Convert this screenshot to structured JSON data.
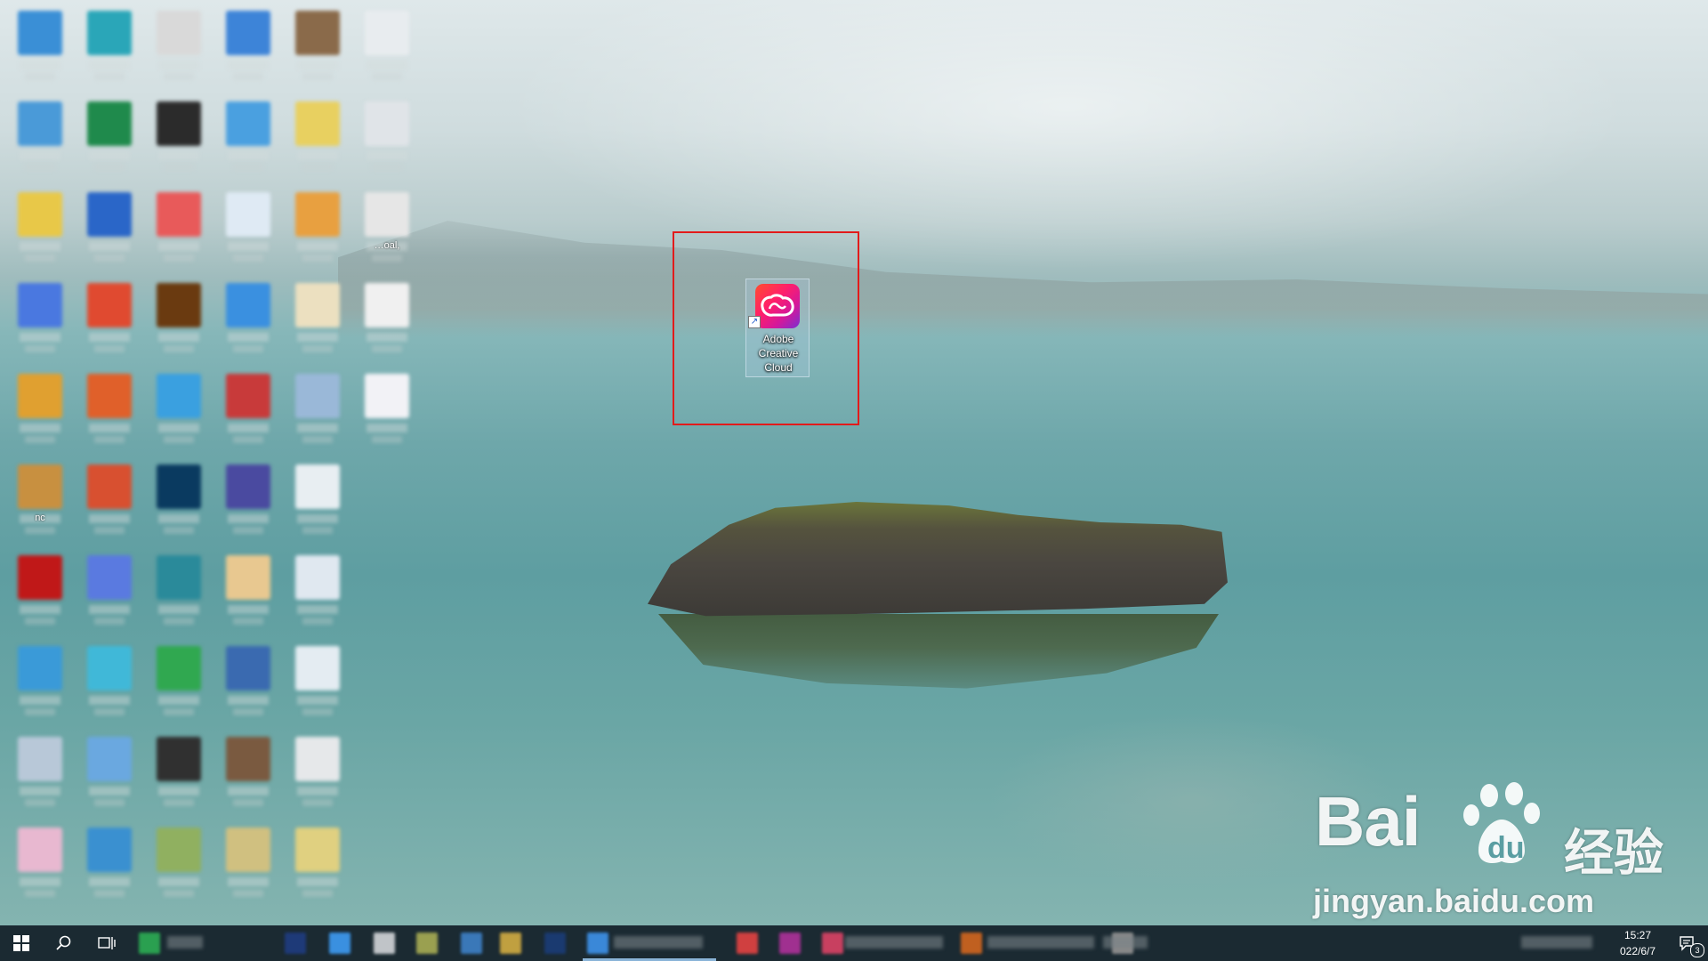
{
  "desktop": {
    "highlighted_shortcut": {
      "label_line1": "Adobe",
      "label_line2": "Creative",
      "label_line3": "Cloud",
      "shortcut_arrow": "↗",
      "icon": "adobe-creative-cloud-icon",
      "highlight_color": "#e21b1b"
    },
    "blurred_icons": [
      {
        "color": "#3a8fd6",
        "text": ""
      },
      {
        "color": "#2aa6b8",
        "text": ""
      },
      {
        "color": "#d9d9d9",
        "text": ""
      },
      {
        "color": "#3d84d8",
        "text": ""
      },
      {
        "color": "#8a6a4a",
        "text": ""
      },
      {
        "color": "#e8ecef",
        "text": ""
      },
      {
        "color": "#4a9ad8",
        "text": ""
      },
      {
        "color": "#1f8a4c",
        "text": ""
      },
      {
        "color": "#2b2b2b",
        "text": ""
      },
      {
        "color": "#4aa0e0",
        "text": ""
      },
      {
        "color": "#e8d060",
        "text": ""
      },
      {
        "color": "#e0e4e8",
        "text": ""
      },
      {
        "color": "#e8c848",
        "text": ""
      },
      {
        "color": "#2a66c8",
        "text": ""
      },
      {
        "color": "#e85a5a",
        "text": ""
      },
      {
        "color": "#dfeaf4",
        "text": ""
      },
      {
        "color": "#e8a040",
        "text": ""
      },
      {
        "color": "#e6e6e6",
        "text": "…oal,"
      },
      {
        "color": "#4a78e0",
        "text": ""
      },
      {
        "color": "#e04a30",
        "text": ""
      },
      {
        "color": "#6a3a10",
        "text": ""
      },
      {
        "color": "#3a90e0",
        "text": ""
      },
      {
        "color": "#ece0c0",
        "text": ""
      },
      {
        "color": "#f0f0f0",
        "text": ""
      },
      {
        "color": "#e0a030",
        "text": ""
      },
      {
        "color": "#e0602a",
        "text": ""
      },
      {
        "color": "#3aa0e0",
        "text": ""
      },
      {
        "color": "#c83a3a",
        "text": ""
      },
      {
        "color": "#9ab8d8",
        "text": ""
      },
      {
        "color": "#f2f2f6",
        "text": ""
      },
      {
        "color": "#c89040",
        "text": "nc"
      },
      {
        "color": "#d85030",
        "text": ""
      },
      {
        "color": "#0a3a60",
        "text": ""
      },
      {
        "color": "#4a4aa0",
        "text": ""
      },
      {
        "color": "#e8eef2",
        "text": ""
      },
      {
        "color": "",
        "text": ""
      },
      {
        "color": "#c01818",
        "text": ""
      },
      {
        "color": "#5a7ae0",
        "text": ""
      },
      {
        "color": "#2a8a9a",
        "text": ""
      },
      {
        "color": "#e8c890",
        "text": ""
      },
      {
        "color": "#e0e8f0",
        "text": ""
      },
      {
        "color": "",
        "text": ""
      },
      {
        "color": "#3a9ad8",
        "text": ""
      },
      {
        "color": "#40b8d8",
        "text": ""
      },
      {
        "color": "#30a850",
        "text": ""
      },
      {
        "color": "#3a6ab0",
        "text": ""
      },
      {
        "color": "#e4ecf2",
        "text": ""
      },
      {
        "color": "",
        "text": ""
      },
      {
        "color": "#b8c8d8",
        "text": ""
      },
      {
        "color": "#6aa8e0",
        "text": ""
      },
      {
        "color": "#303030",
        "text": ""
      },
      {
        "color": "#7a5a40",
        "text": ""
      },
      {
        "color": "#e6e8ea",
        "text": ""
      },
      {
        "color": "",
        "text": ""
      },
      {
        "color": "#e8b8d0",
        "text": ""
      },
      {
        "color": "#3a90d0",
        "text": ""
      },
      {
        "color": "#90b060",
        "text": ""
      },
      {
        "color": "#d0c080",
        "text": ""
      },
      {
        "color": "#e0d080",
        "text": ""
      },
      {
        "color": "",
        "text": ""
      }
    ]
  },
  "watermark": {
    "brand": "Bai",
    "brand_suffix": "du",
    "chinese": "经验",
    "url": "jingyan.baidu.com"
  },
  "taskbar": {
    "clock_time": "15:27",
    "clock_date": "022/6/7",
    "notification_count": "3",
    "start_icon": "windows-start-icon",
    "search_icon": "search-icon",
    "task_view_icon": "task-view-icon",
    "apps": [
      {
        "color": "#2aa050"
      },
      {
        "color": "#1e3a78"
      },
      {
        "color": "#3a90e0"
      },
      {
        "color": "#c0c4c8"
      },
      {
        "color": "#9aa050"
      },
      {
        "color": "#3a78b8"
      },
      {
        "color": "#c0a040"
      },
      {
        "color": "#1a3a70"
      },
      {
        "color": "#3a88d8"
      },
      {
        "color": "#d04040"
      },
      {
        "color": "#a03090"
      },
      {
        "color": "#c84060"
      },
      {
        "color": "#c06020"
      },
      {
        "color": "#8a8a8a"
      }
    ]
  }
}
